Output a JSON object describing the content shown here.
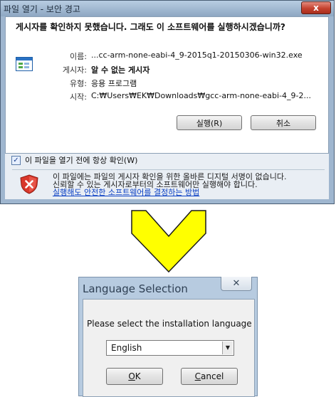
{
  "security_dialog": {
    "title": "파일 열기 - 보안 경고",
    "close_label": "x",
    "question": "게시자를 확인하지 못했습니다. 그래도 이 소프트웨어를 실행하시겠습니까?",
    "fields": [
      {
        "label": "이름:",
        "value": "...cc-arm-none-eabi-4_9-2015q1-20150306-win32.exe",
        "bold": false
      },
      {
        "label": "게시자:",
        "value": "알 수 없는 게시자",
        "bold": true
      },
      {
        "label": "유형:",
        "value": "응용 프로그램",
        "bold": false
      },
      {
        "label": "시작:",
        "value": "C:₩Users₩EK₩Downloads₩gcc-arm-none-eabi-4_9-2...",
        "bold": false
      }
    ],
    "run_button": "실행(R)",
    "cancel_button": "취소",
    "always_check": {
      "label": "이 파일을 열기 전에 항상 확인(W)",
      "checked": true,
      "mark": "✓"
    },
    "warning_text": "이 파일에는 파일의 게시자 확인을 위한 올바른 디지털 서명이 없습니다. 신뢰할 수 있는 게시자로부터의 소프트웨어만 실행해야 합니다.",
    "warning_link": "실행해도 안전한 소프트웨어를 결정하는 방법",
    "colors": {
      "shield": "#d9372b",
      "link": "#0b40c4"
    }
  },
  "arrow": {
    "color": "#ffff00",
    "outline": "#1a1a1a",
    "direction": "down"
  },
  "language_dialog": {
    "title": "Language Selection",
    "close_label": "✕",
    "prompt": "Please select the installation language",
    "selected_language": "English",
    "ok_button": {
      "mnemonic": "O",
      "rest": "K"
    },
    "cancel_button": {
      "mnemonic": "C",
      "rest": "ancel"
    }
  }
}
